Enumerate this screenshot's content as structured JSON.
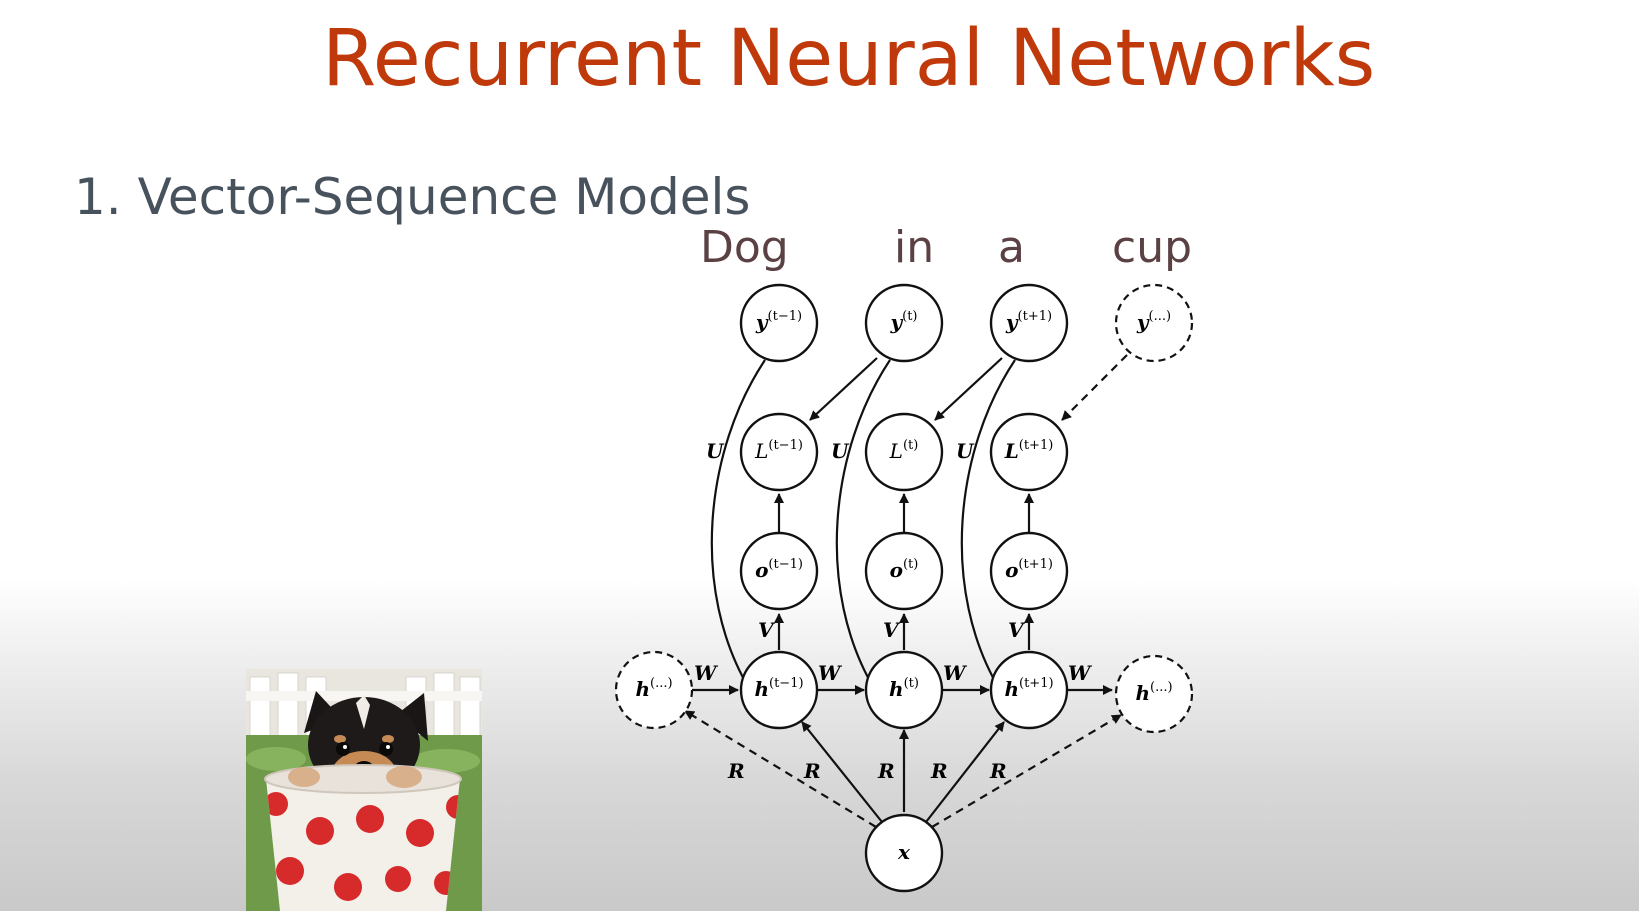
{
  "slide": {
    "title": "Recurrent Neural Networks",
    "subtitle": "1. Vector-Sequence Models",
    "caption_words": [
      "Dog",
      "in",
      "a",
      "cup"
    ]
  },
  "diagram": {
    "nodes": {
      "y_prev": {
        "base": "y",
        "sup": "(t−1)"
      },
      "y_t": {
        "base": "y",
        "sup": "(t)"
      },
      "y_next": {
        "base": "y",
        "sup": "(t+1)"
      },
      "y_more": {
        "base": "y",
        "sup": "(...)"
      },
      "L_prev": {
        "base": "L",
        "sup": "(t−1)"
      },
      "L_t": {
        "base": "L",
        "sup": "(t)"
      },
      "L_next": {
        "base": "L",
        "sup": "(t+1)"
      },
      "o_prev": {
        "base": "o",
        "sup": "(t−1)"
      },
      "o_t": {
        "base": "o",
        "sup": "(t)"
      },
      "o_next": {
        "base": "o",
        "sup": "(t+1)"
      },
      "h_before": {
        "base": "h",
        "sup": "(...)"
      },
      "h_prev": {
        "base": "h",
        "sup": "(t−1)"
      },
      "h_t": {
        "base": "h",
        "sup": "(t)"
      },
      "h_next": {
        "base": "h",
        "sup": "(t+1)"
      },
      "h_after": {
        "base": "h",
        "sup": "(...)"
      },
      "x": {
        "base": "x",
        "sup": ""
      }
    },
    "weight_labels": {
      "U": "U",
      "V": "V",
      "W": "W",
      "R": "R"
    }
  },
  "colors": {
    "title": "#c0390b",
    "subtitle": "#47525c",
    "caption": "#5b4143"
  },
  "image": {
    "subject": "puppy-in-polka-dot-cup"
  }
}
